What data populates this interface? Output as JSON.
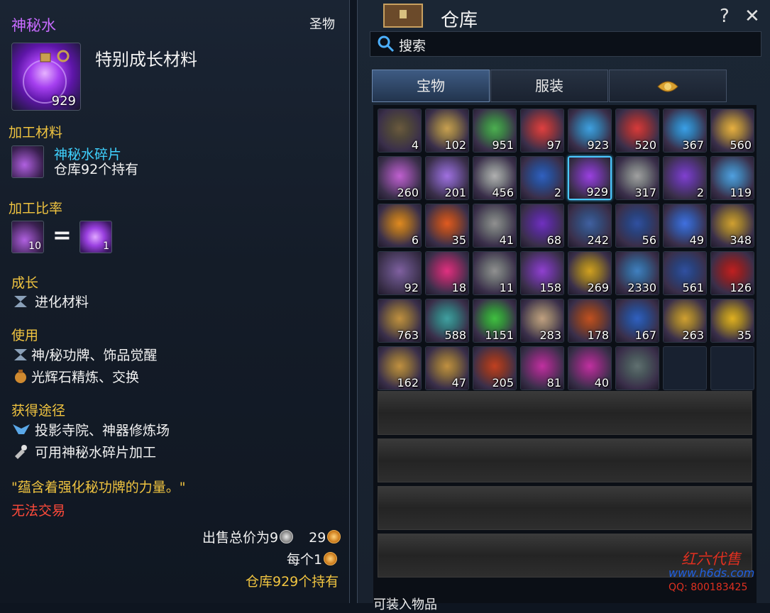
{
  "tooltip": {
    "item_name": "神秘水",
    "category": "圣物",
    "subtitle": "特别成长材料",
    "icon_qty": "929",
    "sec_processing_material": "加工材料",
    "material_name": "神秘水碎片",
    "material_stock": "仓库92个持有",
    "sec_ratio": "加工比率",
    "ratio_left_qty": "10",
    "ratio_equals": "=",
    "ratio_right_qty": "1",
    "sec_growth": "成长",
    "growth_line": "进化材料",
    "sec_use": "使用",
    "use_line1": "神/秘功牌、饰品觉醒",
    "use_line2": "光辉石精炼、交换",
    "sec_obtain": "获得途径",
    "obtain_line1": "投影寺院、神器修炼场",
    "obtain_line2": "可用神秘水碎片加工",
    "flavor": "\"蕴含着强化秘功牌的力量。\"",
    "untradeable": "无法交易",
    "sell_total_label": "出售总价为9",
    "sell_total_copper": "29",
    "each_label": "每个1",
    "stock_line": "仓库929个持有"
  },
  "warehouse": {
    "title": "仓库",
    "help": "?",
    "close": "✕",
    "search_label": "搜索",
    "tabs": [
      "宝物",
      "服装",
      ""
    ],
    "active_tab": 0,
    "footer_text": "可装入物品",
    "items": [
      {
        "qty": "4",
        "color": "#6b5a3e"
      },
      {
        "qty": "102",
        "color": "#c8a050"
      },
      {
        "qty": "951",
        "color": "#4caf50"
      },
      {
        "qty": "97",
        "color": "#e04040"
      },
      {
        "qty": "923",
        "color": "#3fa0e0"
      },
      {
        "qty": "520",
        "color": "#d83a3a"
      },
      {
        "qty": "367",
        "color": "#3aa0e8"
      },
      {
        "qty": "560",
        "color": "#e8b040"
      },
      {
        "qty": "260",
        "color": "#c060d0"
      },
      {
        "qty": "201",
        "color": "#a070e0"
      },
      {
        "qty": "456",
        "color": "#b0b0b0"
      },
      {
        "qty": "2",
        "color": "#3060c0"
      },
      {
        "qty": "929",
        "color": "#9a40e0",
        "selected": true
      },
      {
        "qty": "317",
        "color": "#a0a0a0"
      },
      {
        "qty": "2",
        "color": "#8040d0"
      },
      {
        "qty": "119",
        "color": "#50a0e0"
      },
      {
        "qty": "6",
        "color": "#e08a20"
      },
      {
        "qty": "35",
        "color": "#e05a20"
      },
      {
        "qty": "41",
        "color": "#909090"
      },
      {
        "qty": "68",
        "color": "#7030c0"
      },
      {
        "qty": "242",
        "color": "#4060a0"
      },
      {
        "qty": "56",
        "color": "#3050a0"
      },
      {
        "qty": "49",
        "color": "#4070e0"
      },
      {
        "qty": "348",
        "color": "#d0a030"
      },
      {
        "qty": "92",
        "color": "#8060a0"
      },
      {
        "qty": "18",
        "color": "#e03080"
      },
      {
        "qty": "11",
        "color": "#909090"
      },
      {
        "qty": "158",
        "color": "#9040d0"
      },
      {
        "qty": "269",
        "color": "#d0a020"
      },
      {
        "qty": "2330",
        "color": "#4080c0"
      },
      {
        "qty": "561",
        "color": "#3050a0"
      },
      {
        "qty": "126",
        "color": "#c02020"
      },
      {
        "qty": "763",
        "color": "#c09040"
      },
      {
        "qty": "588",
        "color": "#40a0a0"
      },
      {
        "qty": "1151",
        "color": "#40c040"
      },
      {
        "qty": "283",
        "color": "#c0a080"
      },
      {
        "qty": "178",
        "color": "#c05020"
      },
      {
        "qty": "167",
        "color": "#3060c0"
      },
      {
        "qty": "263",
        "color": "#d0a030"
      },
      {
        "qty": "35",
        "color": "#e0b020"
      },
      {
        "qty": "162",
        "color": "#c09040"
      },
      {
        "qty": "47",
        "color": "#c09040"
      },
      {
        "qty": "205",
        "color": "#c04020"
      },
      {
        "qty": "81",
        "color": "#c030a0"
      },
      {
        "qty": "40",
        "color": "#c030a0"
      },
      {
        "qty": "",
        "color": "#607070"
      },
      {
        "qty": "",
        "color": "",
        "empty": true
      },
      {
        "qty": "",
        "color": "",
        "empty": true
      }
    ]
  },
  "watermark": {
    "line1": "红六代售",
    "line2": "www.h6ds.com",
    "line3": "QQ: 800183425"
  }
}
